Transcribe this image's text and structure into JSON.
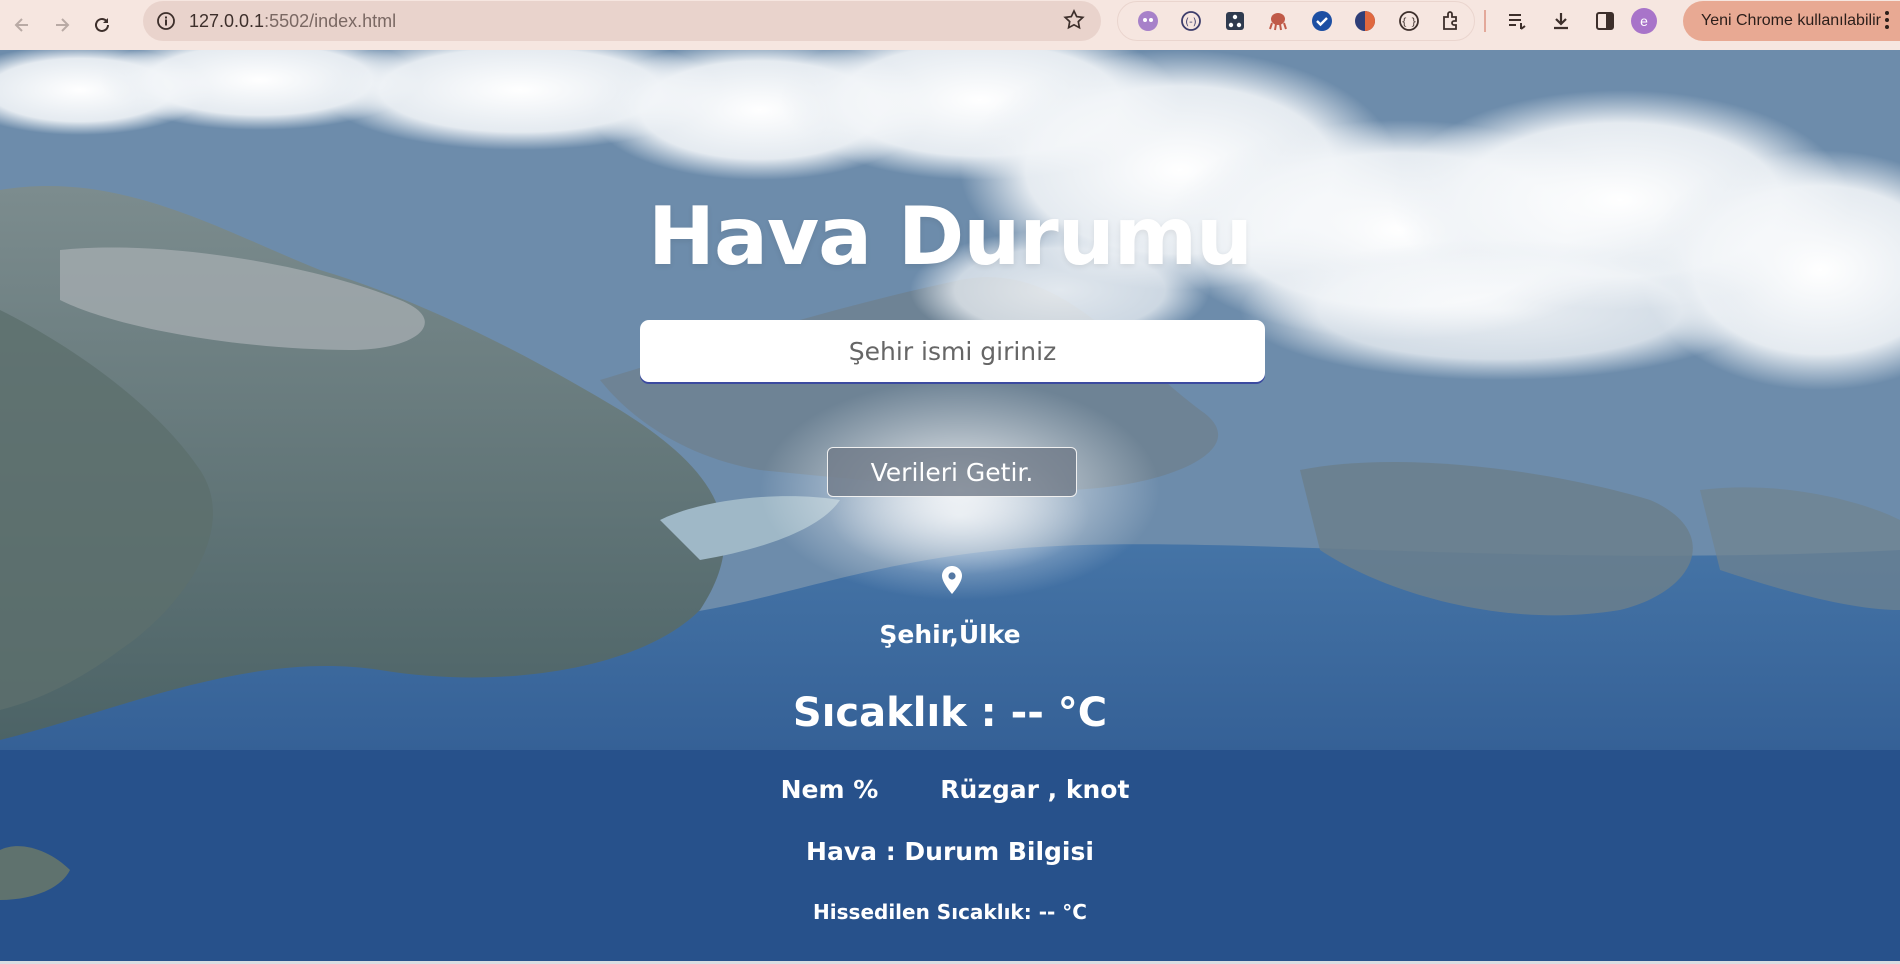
{
  "browser": {
    "url_host": "127.0.0.1",
    "url_rest": ":5502/index.html",
    "profile_label": "Yeni Chrome kullanılabilir",
    "avatar_letter": "e"
  },
  "app": {
    "title": "Hava Durumu",
    "search_placeholder": "Şehir ismi giriniz",
    "fetch_button": "Verileri Getir.",
    "location": "Şehir,Ülke",
    "temperature": "Sıcaklık : -- °C",
    "humidity": "Nem %",
    "wind": "Rüzgar , knot",
    "condition": "Hava : Durum Bilgisi",
    "feels_like": "Hissedilen Sıcaklık: -- °C"
  },
  "colors": {
    "chrome_bg": "#f6e6e0",
    "omnibox_bg": "#e9d3cc",
    "profile_pill": "#e8a993",
    "text_white": "#ffffff"
  }
}
